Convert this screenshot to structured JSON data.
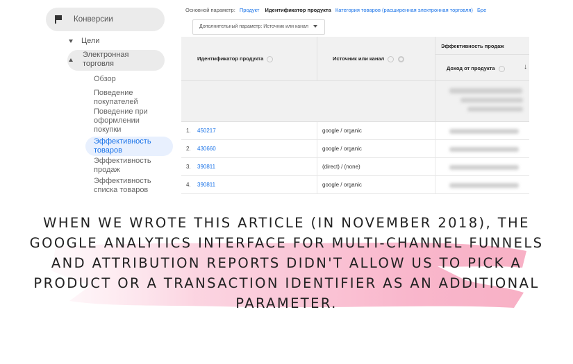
{
  "sidebar": {
    "conversions": "Конверсии",
    "goals": "Цели",
    "ecommerce": "Электронная торговля",
    "items": [
      {
        "label": "Обзор",
        "active": false
      },
      {
        "label": "Поведение покупателей",
        "active": false
      },
      {
        "label": "Поведение при оформлении покупки",
        "active": false
      },
      {
        "label": "Эффективность товаров",
        "active": true
      },
      {
        "label": "Эффективность продаж",
        "active": false
      },
      {
        "label": "Эффективность списка товаров",
        "active": false
      }
    ]
  },
  "report": {
    "primary_label": "Основной параметр:",
    "primary_options": [
      "Продукт",
      "Идентификатор продукта",
      "Категория товаров (расширенная электронная торговля)",
      "Бре"
    ],
    "primary_selected": "Идентификатор продукта",
    "secondary_dropdown": "Дополнительный параметр: Источник или канал"
  },
  "table": {
    "col_product_id": "Идентификатор продукта",
    "col_source": "Источник или канал",
    "group_sales": "Эффективность продаж",
    "col_revenue": "Доход от продукта",
    "rows": [
      {
        "num": "1.",
        "id": "450217",
        "source": "google / organic"
      },
      {
        "num": "2.",
        "id": "430660",
        "source": "google / organic"
      },
      {
        "num": "3.",
        "id": "390811",
        "source": "(direct) / (none)"
      },
      {
        "num": "4.",
        "id": "390811",
        "source": "google / organic"
      }
    ]
  },
  "caption": {
    "text": "When we wrote this article (in November 2018), the Google Analytics interface for Multi-Channel Funnels and Attribution reports didn't allow us to pick a product or a transaction identifier as an additional parameter.",
    "highlight_color": "#f7a8bf"
  }
}
